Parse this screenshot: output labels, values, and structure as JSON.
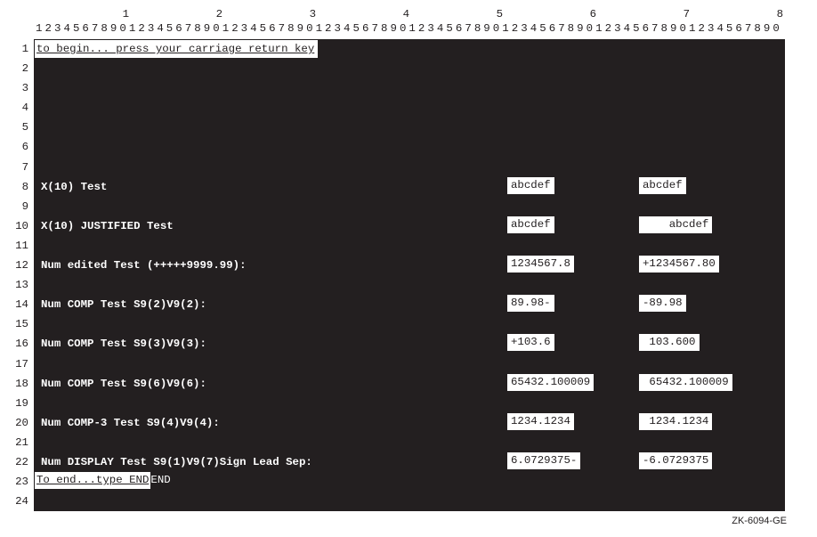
{
  "ruler": {
    "tens": [
      "1",
      "2",
      "3",
      "4",
      "5",
      "6",
      "7",
      "8"
    ],
    "ones": "12345678901234567890123456789012345678901234567890123456789012345678901234567890"
  },
  "line_numbers": [
    "1",
    "2",
    "3",
    "4",
    "5",
    "6",
    "7",
    "8",
    "9",
    "10",
    "11",
    "12",
    "13",
    "14",
    "15",
    "16",
    "17",
    "18",
    "19",
    "20",
    "21",
    "22",
    "23",
    "24"
  ],
  "rows": {
    "r1_prompt": "to begin... press your carriage return key ",
    "r8": {
      "label": "X(10) Test",
      "c1": "abcdef",
      "c2": "abcdef"
    },
    "r10": {
      "label": "X(10) JUSTIFIED Test",
      "c1": "abcdef",
      "c2": "    abcdef"
    },
    "r12": {
      "label": "Num edited Test (+++++9999.99):",
      "c1": "1234567.8",
      "c2": "+1234567.80"
    },
    "r14": {
      "label": "Num COMP Test S9(2)V9(2):",
      "c1": "89.98-",
      "c2": "-89.98"
    },
    "r16": {
      "label": "Num COMP Test S9(3)V9(3):",
      "c1": "+103.6",
      "c2": " 103.600"
    },
    "r18": {
      "label": "Num COMP Test S9(6)V9(6):",
      "c1": "65432.100009",
      "c2": " 65432.100009"
    },
    "r20": {
      "label": "Num COMP-3 Test S9(4)V9(4):",
      "c1": "1234.1234",
      "c2": " 1234.1234"
    },
    "r22": {
      "label": "Num DISPLAY Test S9(1)V9(7)Sign Lead Sep:",
      "c1": "6.0729375-",
      "c2": "-6.0729375"
    },
    "r23": {
      "end_white": " To end...type END",
      "end_dark": "END"
    }
  },
  "figure_label": "ZK-6094-GE"
}
